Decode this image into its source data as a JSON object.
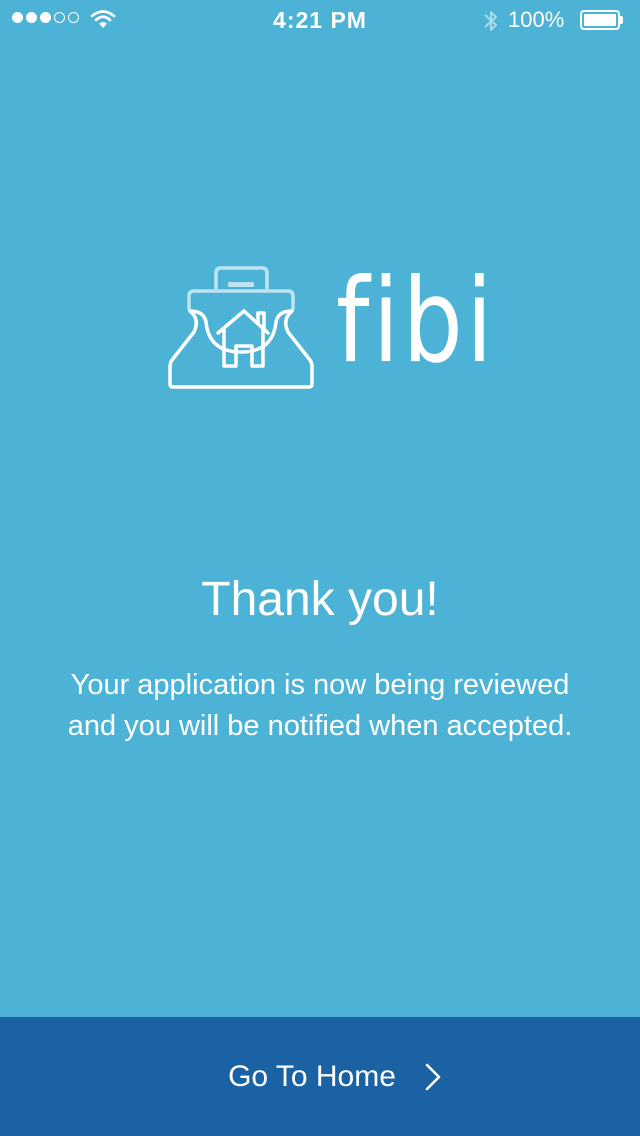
{
  "status_bar": {
    "signal_dots_filled": 3,
    "signal_dots_total": 5,
    "wifi_icon": "wifi-icon",
    "time": "4:21 PM",
    "bluetooth_icon": "bluetooth-icon",
    "battery_percent": "100%",
    "battery_level": 1.0
  },
  "brand": {
    "logo_icon": "bag-with-house-icon",
    "wordmark": "fibi"
  },
  "content": {
    "title": "Thank you!",
    "message": "Your application is now being reviewed and you will be notified when accepted."
  },
  "footer": {
    "button_label": "Go To Home",
    "chevron_icon": "chevron-right-icon"
  },
  "colors": {
    "background": "#4db3d6",
    "footer_background": "#1b62a4",
    "text": "#ffffff"
  }
}
